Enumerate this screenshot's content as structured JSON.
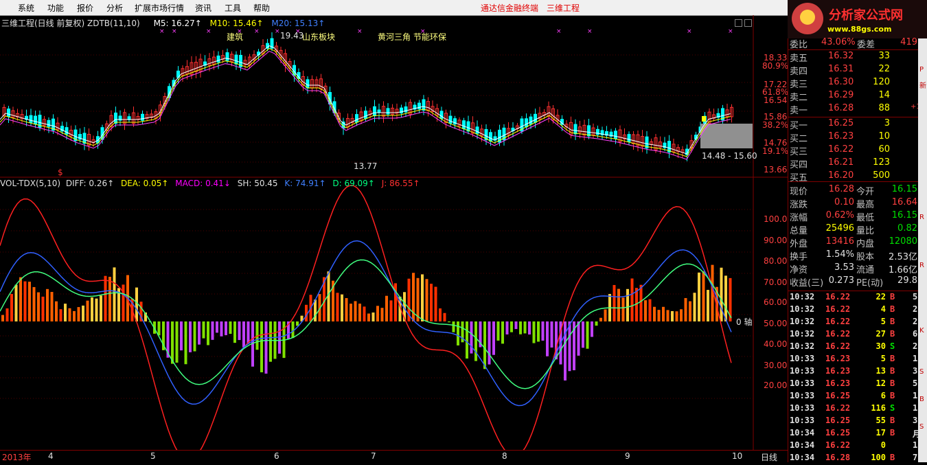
{
  "menu": {
    "items": [
      "系统",
      "功能",
      "报价",
      "分析",
      "扩展市场行情",
      "资讯",
      "工具",
      "帮助"
    ],
    "app_title": "通达信金融终端",
    "stock_title": "三维工程"
  },
  "main_chart": {
    "header": "三维工程(日线 前复权) ZDTB(11,10)",
    "ma5": "M5: 16.27↑",
    "ma10": "M10: 15.46↑",
    "ma20": "M20: 15.13↑",
    "annotations": [
      "建筑",
      "19.43",
      "山东板块",
      "黄河三角",
      "节能环保"
    ],
    "high_label": "19.43",
    "low_label": "13.77",
    "range_label": "14.48 - 15.60",
    "price_axis": [
      "18.33",
      "80.9%",
      "17.22",
      "61.8%",
      "16.54",
      "15.86",
      "38.2%",
      "14.76",
      "19.1%",
      "13.66"
    ],
    "dollar": "$",
    "colors": {
      "up": "#ff3030",
      "down": "#00ffff",
      "ma5": "#ffffff",
      "ma10": "#ffff00",
      "ma20": "#ff00ff"
    }
  },
  "indicator": {
    "header": "VOL-TDX(5,10)",
    "diff": "DIFF: 0.26↑",
    "dea": "DEA: 0.05↑",
    "macd": "MACD: 0.41↓",
    "sh": "SH: 50.45",
    "k": "K: 74.91↑",
    "d": "D: 69.09↑",
    "j": "J: 86.55↑",
    "axis": [
      "100.0",
      "90.00",
      "80.00",
      "70.00",
      "60.00",
      "50.00",
      "40.00",
      "30.00",
      "20.00"
    ],
    "zero_label": "0 轴"
  },
  "time_axis": {
    "labels": [
      "2013年",
      "4",
      "5",
      "6",
      "7",
      "8",
      "9",
      "10"
    ],
    "period": "日线"
  },
  "quote": {
    "weibi_label": "委比",
    "weibi": "43.06%",
    "weicha_label": "委差",
    "weicha": "419",
    "sells": [
      {
        "label": "卖五",
        "price": "16.32",
        "vol": "33"
      },
      {
        "label": "卖四",
        "price": "16.31",
        "vol": "22"
      },
      {
        "label": "卖三",
        "price": "16.30",
        "vol": "120"
      },
      {
        "label": "卖二",
        "price": "16.29",
        "vol": "14"
      },
      {
        "label": "卖一",
        "price": "16.28",
        "vol": "88",
        "extra": "+1"
      }
    ],
    "buys": [
      {
        "label": "买一",
        "price": "16.25",
        "vol": "3"
      },
      {
        "label": "买二",
        "price": "16.23",
        "vol": "10"
      },
      {
        "label": "买三",
        "price": "16.22",
        "vol": "60"
      },
      {
        "label": "买四",
        "price": "16.21",
        "vol": "123"
      },
      {
        "label": "买五",
        "price": "16.20",
        "vol": "500"
      }
    ],
    "stats": [
      {
        "l1": "现价",
        "v1": "16.28",
        "l2": "今开",
        "v2": "16.15"
      },
      {
        "l1": "涨跌",
        "v1": "0.10",
        "l2": "最高",
        "v2": "16.64"
      },
      {
        "l1": "涨幅",
        "v1": "0.62%",
        "l2": "最低",
        "v2": "16.15"
      },
      {
        "l1": "总量",
        "v1": "25496",
        "l2": "量比",
        "v2": "0.82"
      },
      {
        "l1": "外盘",
        "v1": "13416",
        "l2": "内盘",
        "v2": "12080"
      },
      {
        "l1": "换手",
        "v1": "1.54%",
        "l2": "股本",
        "v2": "2.53亿"
      },
      {
        "l1": "净资",
        "v1": "3.53",
        "l2": "流通",
        "v2": "1.66亿"
      },
      {
        "l1": "收益(三)",
        "v1": "0.273",
        "l2": "PE(动)",
        "v2": "29.8"
      }
    ],
    "ticks": [
      {
        "t": "10:32",
        "p": "16.22",
        "v": "22",
        "bs": "B",
        "n": "5"
      },
      {
        "t": "10:32",
        "p": "16.22",
        "v": "4",
        "bs": "B",
        "n": "2"
      },
      {
        "t": "10:32",
        "p": "16.22",
        "v": "5",
        "bs": "B",
        "n": "2"
      },
      {
        "t": "10:32",
        "p": "16.22",
        "v": "27",
        "bs": "B",
        "n": "6"
      },
      {
        "t": "10:32",
        "p": "16.22",
        "v": "30",
        "bs": "S",
        "n": "2"
      },
      {
        "t": "10:33",
        "p": "16.23",
        "v": "5",
        "bs": "B",
        "n": "1"
      },
      {
        "t": "10:33",
        "p": "16.23",
        "v": "13",
        "bs": "B",
        "n": "3"
      },
      {
        "t": "10:33",
        "p": "16.23",
        "v": "12",
        "bs": "B",
        "n": "5"
      },
      {
        "t": "10:33",
        "p": "16.25",
        "v": "6",
        "bs": "B",
        "n": "1"
      },
      {
        "t": "10:33",
        "p": "16.22",
        "v": "116",
        "bs": "S",
        "n": "1"
      },
      {
        "t": "10:33",
        "p": "16.25",
        "v": "55",
        "bs": "B",
        "n": "3"
      },
      {
        "t": "10:34",
        "p": "16.25",
        "v": "17",
        "bs": "B",
        "n": "月"
      },
      {
        "t": "10:34",
        "p": "16.22",
        "v": "0",
        "bs": "",
        "n": "1"
      },
      {
        "t": "10:34",
        "p": "16.28",
        "v": "100",
        "bs": "B",
        "n": "7"
      }
    ]
  },
  "logo": {
    "title": "分析家公式网",
    "url": "www.88gs.com"
  },
  "scroll_marks": [
    "P",
    "新",
    "R",
    "R",
    "K",
    "S",
    "B",
    "S"
  ]
}
